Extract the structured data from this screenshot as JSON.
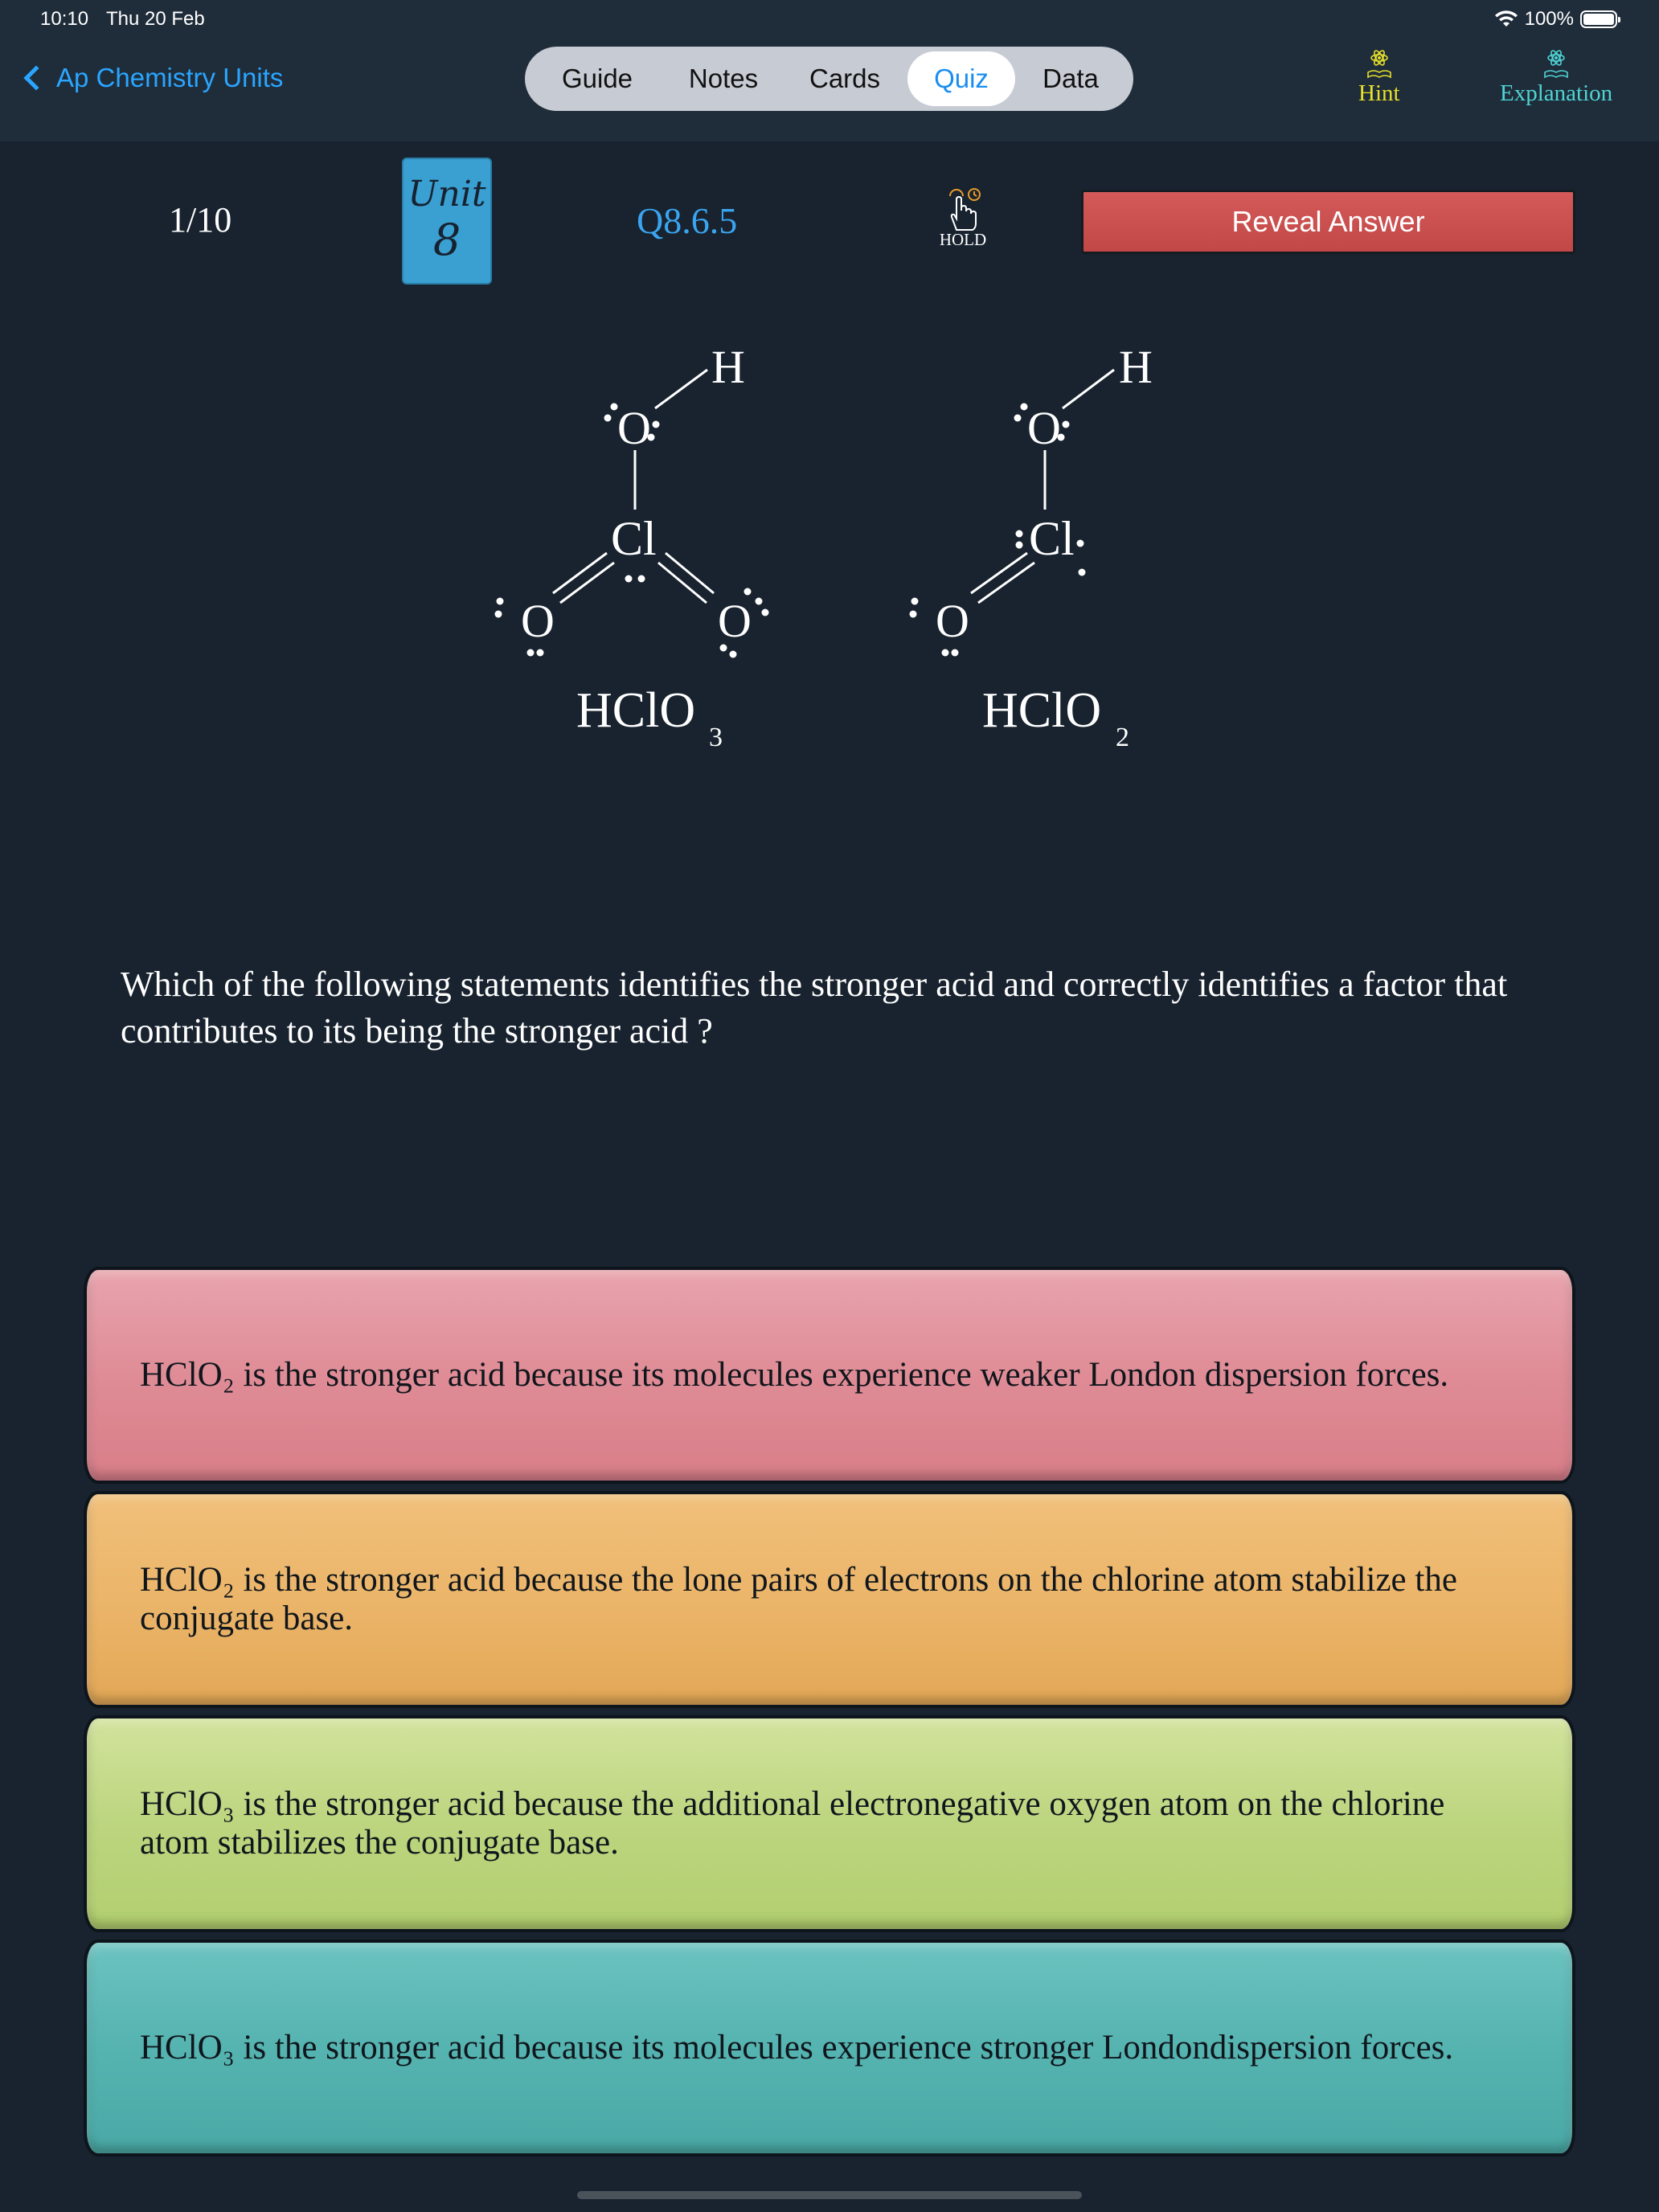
{
  "status_bar": {
    "time": "10:10",
    "date": "Thu 20 Feb",
    "battery": "100%"
  },
  "nav": {
    "back_label": "Ap Chemistry Units",
    "tabs": [
      {
        "label": "Guide",
        "active": false
      },
      {
        "label": "Notes",
        "active": false
      },
      {
        "label": "Cards",
        "active": false
      },
      {
        "label": "Quiz",
        "active": true
      },
      {
        "label": "Data",
        "active": false
      }
    ],
    "hint_label": "Hint",
    "explanation_label": "Explanation"
  },
  "quiz": {
    "counter": "1/10",
    "unit_label": "Unit",
    "unit_number": "8",
    "question_code": "Q8.6.5",
    "hold_label": "HOLD",
    "reveal_label": "Reveal Answer",
    "question": "Which of the following statements identifies the stronger acid and correctly identifies a factor that contributes to its being the stronger acid ?",
    "answers": [
      {
        "text": "HClO₂ is the stronger acid because its molecules experience weaker London dispersion forces.",
        "color": "#df8c96"
      },
      {
        "text": "HClO₂ is the stronger acid because the lone pairs of electrons on the chlorine atom stabilize the conjugate base.",
        "color": "#ebb56a"
      },
      {
        "text": "HClO₃ is the stronger acid because the additional electronegative oxygen atom on the chlorine atom stabilizes the conjugate base.",
        "color": "#bcd57f"
      },
      {
        "text": "HClO₃ is the stronger acid because its molecules experience stronger Londondispersion forces.",
        "color": "#55b3b0"
      }
    ]
  },
  "structures": {
    "left": {
      "formula": "HClO",
      "subscript": "3",
      "atoms": {
        "h": "H",
        "o_top": "O",
        "cl": "Cl",
        "o_left": "O",
        "o_right": "O"
      }
    },
    "right": {
      "formula": "HClO",
      "subscript": "2",
      "atoms": {
        "h": "H",
        "o_top": "O",
        "cl": "Cl",
        "o_left": "O"
      }
    }
  },
  "colors": {
    "background": "#18232f",
    "nav": "#1f2c3a",
    "accent": "#2aa6ff",
    "reveal": "#c94d4d",
    "unit_badge": "#3a9fd1"
  },
  "icons": {
    "back": "chevron-left-icon",
    "hint": "atom-book-icon",
    "explanation": "atom-book-icon",
    "hold": "hand-tap-icon"
  }
}
